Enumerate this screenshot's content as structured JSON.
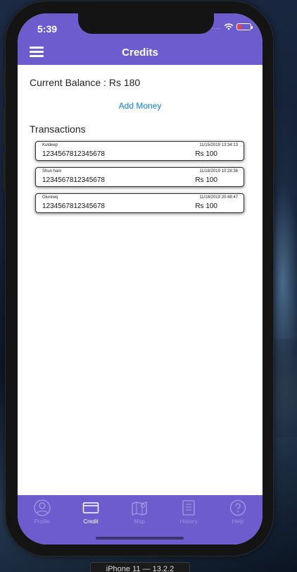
{
  "status_bar": {
    "time": "5:39",
    "signal": "...."
  },
  "header": {
    "title": "Credits"
  },
  "balance": {
    "text": "Current Balance : Rs 180"
  },
  "actions": {
    "add_money": "Add Money"
  },
  "transactions_title": "Transactions",
  "transactions": [
    {
      "name": "Kuldeep",
      "number": "1234567812345678",
      "datetime": "11/15/2019 13:34:13",
      "amount": "Rs  100"
    },
    {
      "name": "Shun ham",
      "number": "1234567812345678",
      "datetime": "11/18/2019 10:28:38",
      "amount": "Rs  100"
    },
    {
      "name": "Oiurewq",
      "number": "1234567812345678",
      "datetime": "11/18/2019 20:48:47",
      "amount": "Rs  100"
    }
  ],
  "tabs": [
    {
      "label": "Profile",
      "icon": "profile-icon",
      "active": false
    },
    {
      "label": "Credit",
      "icon": "credit-card-icon",
      "active": true
    },
    {
      "label": "Map",
      "icon": "map-icon",
      "active": false
    },
    {
      "label": "History",
      "icon": "history-icon",
      "active": false
    },
    {
      "label": "Help",
      "icon": "help-icon",
      "active": false
    }
  ],
  "device_label": "iPhone 11 — 13.2.2",
  "colors": {
    "accent": "#6c5ccd",
    "link": "#0b7be0",
    "tab_active": "#ffffff",
    "tab_inactive": "#9d92e0"
  }
}
